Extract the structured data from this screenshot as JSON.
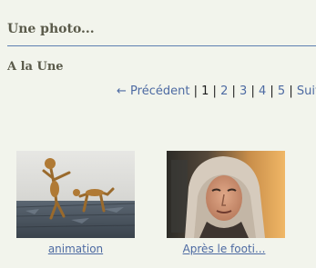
{
  "section": {
    "title": "Une photo..."
  },
  "feature": {
    "title": "A la Une"
  },
  "pagination": {
    "prev_label": "← Précédent",
    "separator": "|",
    "current": "1",
    "pages": [
      "2",
      "3",
      "4",
      "5"
    ],
    "next_label": "Suiv"
  },
  "gallery": {
    "items": [
      {
        "caption": "animation",
        "icon": "animation-figurines-image"
      },
      {
        "caption": "Après le footi...",
        "icon": "portrait-towel-image"
      }
    ]
  },
  "colors": {
    "background": "#f2f4ec",
    "link": "#4d6aa2",
    "heading": "#5a5a4a",
    "divider": "#5d7fb0"
  }
}
